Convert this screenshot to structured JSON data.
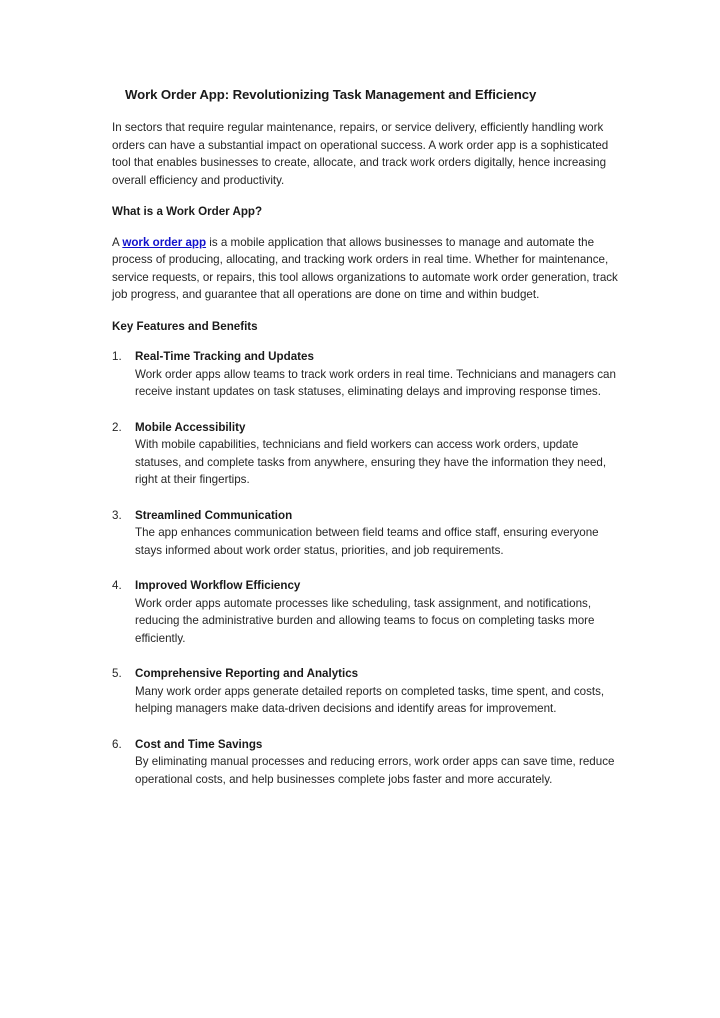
{
  "document": {
    "title": "Work Order App: Revolutionizing Task Management and Efficiency",
    "intro_paragraph": "In sectors that require regular maintenance, repairs, or service delivery, efficiently handling work orders can have a substantial impact on operational success. A work order app is a sophisticated tool that enables businesses to create, allocate, and track work orders digitally, hence increasing overall efficiency and productivity.",
    "section_what_is": {
      "heading": "What is a Work Order App?",
      "text_before_link": "A ",
      "link_text": "work order app",
      "link_color": "#1111cc",
      "text_after_link": " is a mobile application that allows businesses to manage and automate the process of producing, allocating, and tracking work orders in real time. Whether for maintenance, service requests, or repairs, this tool allows organizations to automate work order generation, track job progress, and guarantee that all operations are done on time and within budget."
    },
    "section_features": {
      "heading": "Key Features and Benefits",
      "items": [
        {
          "number": "1.",
          "title": "Real-Time Tracking and Updates",
          "text": "Work order apps allow teams to track work orders in real time. Technicians and managers can receive instant updates on task statuses, eliminating delays and improving response times."
        },
        {
          "number": "2.",
          "title": "Mobile Accessibility",
          "text": "With mobile capabilities, technicians and field workers can access work orders, update statuses, and complete tasks from anywhere, ensuring they have the information they need, right at their fingertips."
        },
        {
          "number": "3.",
          "title": "Streamlined Communication",
          "text": "The app enhances communication between field teams and office staff, ensuring everyone stays informed about work order status, priorities, and job requirements."
        },
        {
          "number": "4.",
          "title": "Improved Workflow Efficiency",
          "text": "Work order apps automate processes like scheduling, task assignment, and notifications, reducing the administrative burden and allowing teams to focus on completing tasks more efficiently."
        },
        {
          "number": "5.",
          "title": "Comprehensive Reporting and Analytics",
          "text": "Many work order apps generate detailed reports on completed tasks, time spent, and costs, helping managers make data-driven decisions and identify areas for improvement."
        },
        {
          "number": "6.",
          "title": "Cost and Time Savings",
          "text": "By eliminating manual processes and reducing errors, work order apps can save time, reduce operational costs, and help businesses complete jobs faster and more accurately."
        }
      ]
    }
  }
}
